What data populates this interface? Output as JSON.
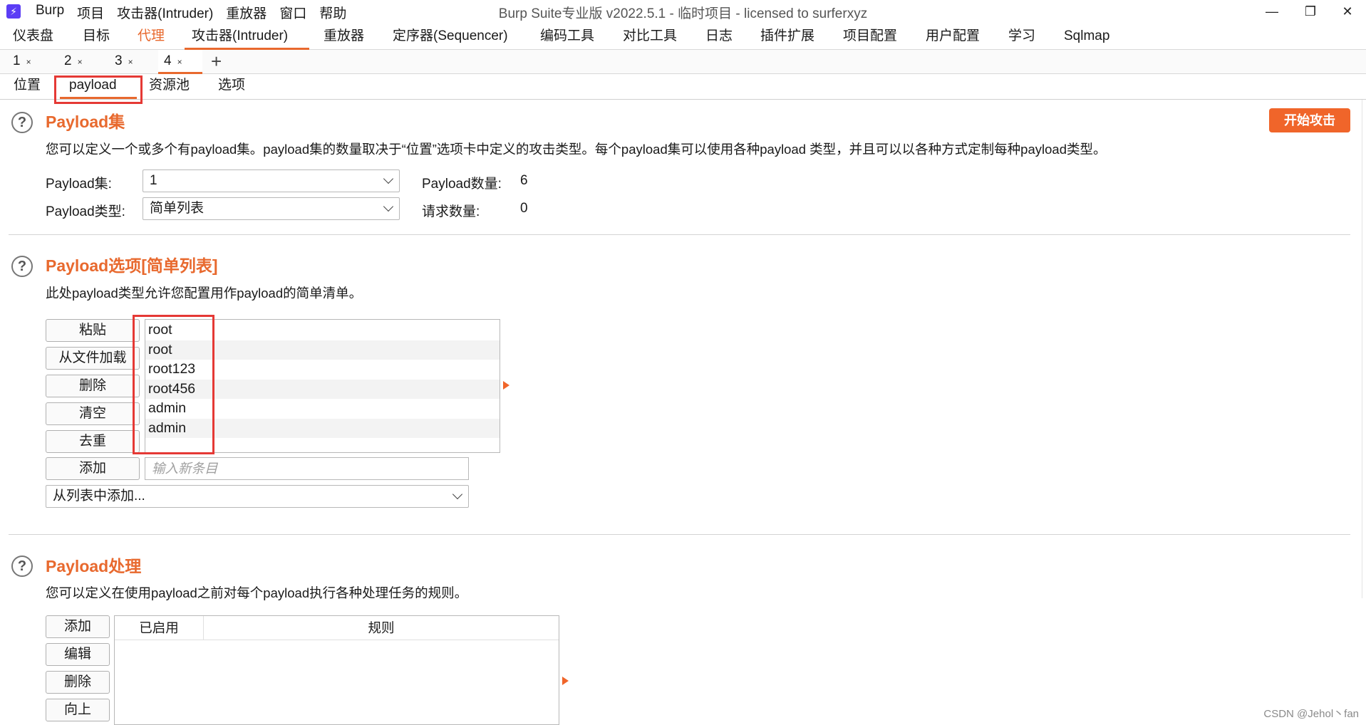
{
  "titlebar": {
    "menu": [
      "Burp",
      "项目",
      "攻击器(Intruder)",
      "重放器",
      "窗口",
      "帮助"
    ],
    "window_title": "Burp Suite专业版  v2022.5.1 - 临时项目 - licensed to surferxyz",
    "minimize": "—",
    "maximize": "❐",
    "close": "✕"
  },
  "main_tabs": [
    "仪表盘",
    "目标",
    "代理",
    "攻击器(Intruder)",
    "重放器",
    "定序器(Sequencer)",
    "编码工具",
    "对比工具",
    "日志",
    "插件扩展",
    "项目配置",
    "用户配置",
    "学习",
    "Sqlmap"
  ],
  "num_tabs": [
    "1",
    "2",
    "3",
    "4"
  ],
  "tab_close": "×",
  "tab_add": "+",
  "sub_tabs": [
    "位置",
    "payload",
    "资源池",
    "选项"
  ],
  "start_attack": "开始攻击",
  "help_glyph": "?",
  "payload_sets": {
    "title": "Payload集",
    "desc": "您可以定义一个或多个有payload集。payload集的数量取决于“位置”选项卡中定义的攻击类型。每个payload集可以使用各种payload 类型，并且可以以各种方式定制每种payload类型。",
    "set_label": "Payload集:",
    "set_value": "1",
    "type_label": "Payload类型:",
    "type_value": "简单列表",
    "count_label": "Payload数量:",
    "count_value": "6",
    "req_label": "请求数量:",
    "req_value": "0"
  },
  "payload_options": {
    "title": "Payload选项[简单列表]",
    "desc": "此处payload类型允许您配置用作payload的简单清单。",
    "buttons": [
      "粘贴",
      "从文件加载",
      "删除",
      "清空",
      "去重"
    ],
    "items": [
      "root",
      "root",
      "root123",
      "root456",
      "admin",
      "admin"
    ],
    "add_button": "添加",
    "new_entry_placeholder": "输入新条目",
    "add_from_list": "从列表中添加..."
  },
  "payload_processing": {
    "title": "Payload处理",
    "desc": "您可以定义在使用payload之前对每个payload执行各种处理任务的规则。",
    "buttons": [
      "添加",
      "编辑",
      "删除",
      "向上"
    ],
    "col_enabled": "已启用",
    "col_rule": "规则"
  },
  "watermark": "CSDN @Jehol丶fan",
  "colors": {
    "accent": "#e8692e",
    "highlight_box": "#e53935",
    "app_icon": "#5b3df5"
  }
}
